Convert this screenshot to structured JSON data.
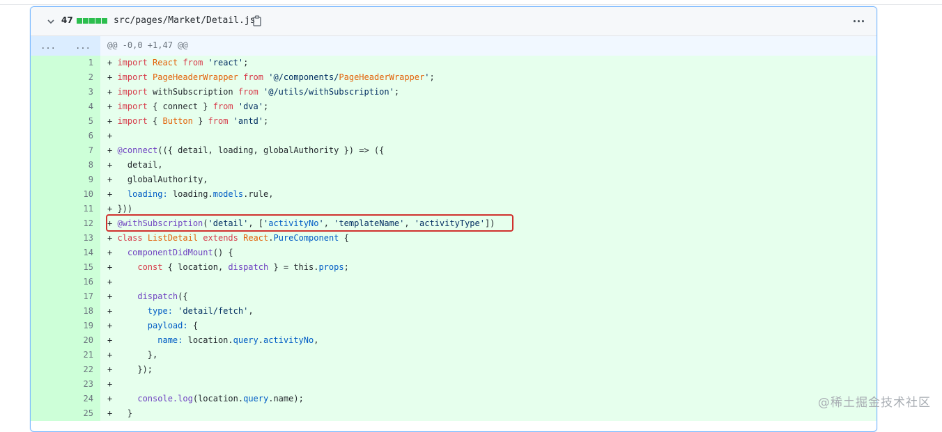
{
  "file": {
    "changes_count": "47",
    "path": "src/pages/Market/Detail.js"
  },
  "hunk": {
    "expand_left": "...",
    "expand_right": "...",
    "header": "@@ -0,0 +1,47 @@"
  },
  "lines": [
    {
      "num": "1",
      "code": "+ import React from 'react';"
    },
    {
      "num": "2",
      "code": "+ import PageHeaderWrapper from '@/components/PageHeaderWrapper';"
    },
    {
      "num": "3",
      "code": "+ import withSubscription from '@/utils/withSubscription';"
    },
    {
      "num": "4",
      "code": "+ import { connect } from 'dva';"
    },
    {
      "num": "5",
      "code": "+ import { Button } from 'antd';"
    },
    {
      "num": "6",
      "code": "+"
    },
    {
      "num": "7",
      "code": "+ @connect(({ detail, loading, globalAuthority }) => ({"
    },
    {
      "num": "8",
      "code": "+   detail,"
    },
    {
      "num": "9",
      "code": "+   globalAuthority,"
    },
    {
      "num": "10",
      "code": "+   loading: loading.models.rule,"
    },
    {
      "num": "11",
      "code": "+ }))"
    },
    {
      "num": "12",
      "code": "+ @withSubscription('detail', ['activityNo', 'templateName', 'activityType'])"
    },
    {
      "num": "13",
      "code": "+ class ListDetail extends React.PureComponent {"
    },
    {
      "num": "14",
      "code": "+   componentDidMount() {"
    },
    {
      "num": "15",
      "code": "+     const { location, dispatch } = this.props;"
    },
    {
      "num": "16",
      "code": "+"
    },
    {
      "num": "17",
      "code": "+     dispatch({"
    },
    {
      "num": "18",
      "code": "+       type: 'detail/fetch',"
    },
    {
      "num": "19",
      "code": "+       payload: {"
    },
    {
      "num": "20",
      "code": "+         name: location.query.activityNo,"
    },
    {
      "num": "21",
      "code": "+       },"
    },
    {
      "num": "22",
      "code": "+     });"
    },
    {
      "num": "23",
      "code": "+"
    },
    {
      "num": "24",
      "code": "+     console.log(location.query.name);"
    },
    {
      "num": "25",
      "code": "+   }"
    }
  ],
  "watermark": "@稀土掘金技术社区",
  "colors": {
    "addition_bg": "#e6ffed",
    "addition_gutter": "#cdffd8",
    "highlight_box": "#d0312d",
    "diffstat_green": "#2cbe4e"
  }
}
